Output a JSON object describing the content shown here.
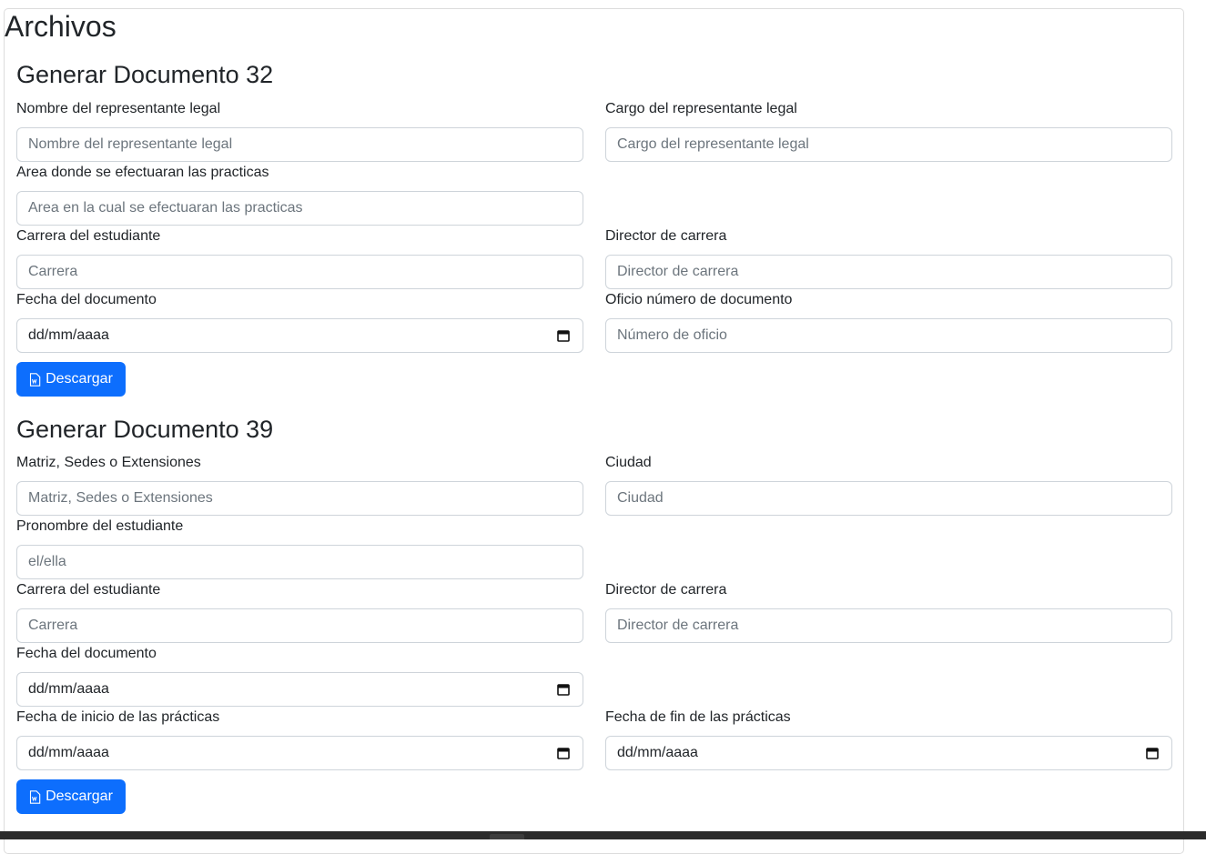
{
  "page": {
    "title": "Archivos"
  },
  "doc32": {
    "title": "Generar Documento 32",
    "rep_nombre_label": "Nombre del representante legal",
    "rep_nombre_placeholder": "Nombre del representante legal",
    "rep_cargo_label": "Cargo del representante legal",
    "rep_cargo_placeholder": "Cargo del representante legal",
    "area_label": "Area donde se efectuaran las practicas",
    "area_placeholder": "Area en la cual se efectuaran las practicas",
    "carrera_label": "Carrera del estudiante",
    "carrera_placeholder": "Carrera",
    "director_label": "Director de carrera",
    "director_placeholder": "Director de carrera",
    "fecha_label": "Fecha del documento",
    "fecha_value": "dd/mm/aaaa",
    "oficio_label": "Oficio número de documento",
    "oficio_placeholder": "Número de oficio",
    "download_label": "Descargar"
  },
  "doc39": {
    "title": "Generar Documento 39",
    "matriz_label": "Matriz, Sedes o Extensiones",
    "matriz_placeholder": "Matriz, Sedes o Extensiones",
    "ciudad_label": "Ciudad",
    "ciudad_placeholder": "Ciudad",
    "pronombre_label": "Pronombre del estudiante",
    "pronombre_placeholder": "el/ella",
    "carrera_label": "Carrera del estudiante",
    "carrera_placeholder": "Carrera",
    "director_label": "Director de carrera",
    "director_placeholder": "Director de carrera",
    "fecha_label": "Fecha del documento",
    "fecha_value": "dd/mm/aaaa",
    "inicio_label": "Fecha de inicio de las prácticas",
    "inicio_value": "dd/mm/aaaa",
    "fin_label": "Fecha de fin de las prácticas",
    "fin_value": "dd/mm/aaaa",
    "download_label": "Descargar"
  },
  "colors": {
    "primary": "#0d6efd",
    "border": "#ced4da",
    "placeholder": "#6c757d"
  }
}
